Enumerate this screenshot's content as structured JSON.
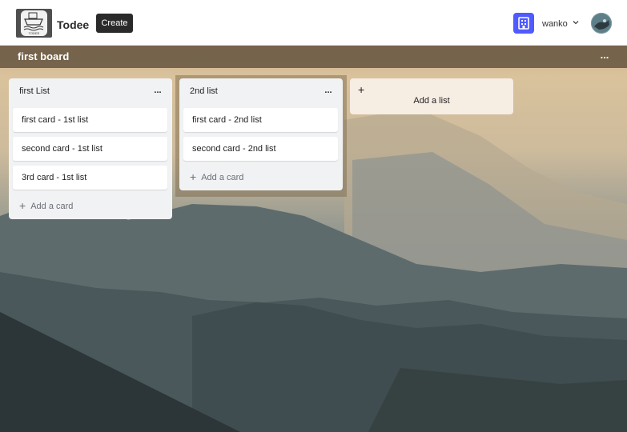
{
  "app": {
    "name": "Todee",
    "logo_caption": "TODEE",
    "create_label": "Create"
  },
  "user": {
    "name": "wanko",
    "workspace_icon": "building-icon",
    "avatar_icon": "avatar-icon"
  },
  "board": {
    "title": "first board",
    "menu_label": "...",
    "lists": [
      {
        "title": "first List",
        "menu_label": "...",
        "cards": [
          "first card - 1st list",
          "second card - 1st list",
          "3rd card - 1st list"
        ],
        "add_card_label": "Add a card"
      },
      {
        "title": "2nd list",
        "menu_label": "...",
        "cards": [
          "first card - 2nd list",
          "second card - 2nd list"
        ],
        "add_card_label": "Add a card"
      }
    ],
    "add_list_label": "Add a list"
  },
  "colors": {
    "create_button": "#2a2a2a",
    "workspace_icon": "#4f5bff",
    "list_background": "#f1f2f4",
    "add_list_background": "#f6ede3"
  }
}
